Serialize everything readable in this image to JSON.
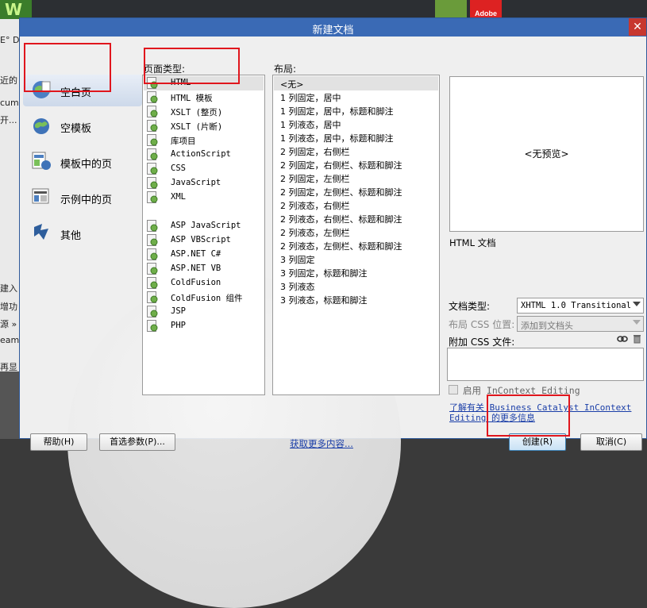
{
  "background": {
    "logo_letter": "W",
    "snippets": [
      "E° D",
      "近的",
      "cume",
      "开...",
      "建入",
      "增功",
      "源 »",
      "eamv",
      "再显"
    ],
    "adobe_label": "Adobe"
  },
  "dialog": {
    "title": "新建文档",
    "close_label": "✕"
  },
  "categories": [
    {
      "label": "空白页",
      "icon": "blank-page-icon",
      "active": true
    },
    {
      "label": "空模板",
      "icon": "blank-template-icon",
      "active": false
    },
    {
      "label": "模板中的页",
      "icon": "page-from-template-icon",
      "active": false
    },
    {
      "label": "示例中的页",
      "icon": "page-from-sample-icon",
      "active": false
    },
    {
      "label": "其他",
      "icon": "other-icon",
      "active": false
    }
  ],
  "page_type": {
    "header": "页面类型:",
    "items": [
      "HTML",
      "HTML 模板",
      "XSLT (整页)",
      "XSLT (片断)",
      "库项目",
      "ActionScript",
      "CSS",
      "JavaScript",
      "XML",
      "",
      "ASP JavaScript",
      "ASP VBScript",
      "ASP.NET C#",
      "ASP.NET VB",
      "ColdFusion",
      "ColdFusion 组件",
      "JSP",
      "PHP"
    ],
    "selected_index": 0
  },
  "layout": {
    "header": "布局:",
    "items": [
      "<无>",
      "1 列固定，居中",
      "1 列固定，居中，标题和脚注",
      "1 列液态，居中",
      "1 列液态，居中，标题和脚注",
      "2 列固定，右侧栏",
      "2 列固定，右侧栏、标题和脚注",
      "2 列固定，左侧栏",
      "2 列固定，左侧栏、标题和脚注",
      "2 列液态，右侧栏",
      "2 列液态，右侧栏、标题和脚注",
      "2 列液态，左侧栏",
      "2 列液态，左侧栏、标题和脚注",
      "3 列固定",
      "3 列固定，标题和脚注",
      "3 列液态",
      "3 列液态，标题和脚注"
    ],
    "selected_index": 0
  },
  "preview": {
    "placeholder": "<无预览>",
    "description": "HTML 文档"
  },
  "form": {
    "doctype_label": "文档类型:",
    "doctype_value": "XHTML 1.0 Transitional",
    "css_position_label": "布局 CSS 位置:",
    "css_position_value": "添加到文档头",
    "attach_css_label": "附加 CSS 文件:",
    "incontext_label": "启用 InContext Editing",
    "learn_more": "了解有关 Business Catalyst InContext Editing 的更多信息"
  },
  "buttons": {
    "help": "帮助(H)",
    "preferences": "首选参数(P)...",
    "get_more": "获取更多内容...",
    "create": "创建(R)",
    "cancel": "取消(C)"
  },
  "colors": {
    "titlebar": "#3a6ab5",
    "close": "#c7372f",
    "annotation": "#e0161d",
    "link": "#1a3ea8"
  }
}
